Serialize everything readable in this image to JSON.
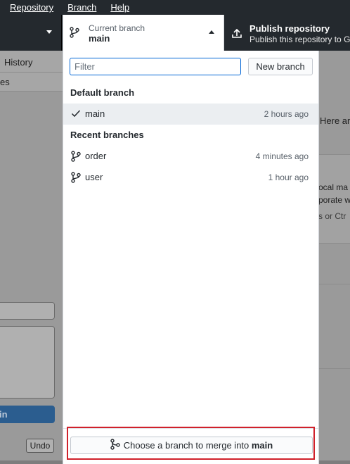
{
  "menu": {
    "items": [
      {
        "label": "Repository"
      },
      {
        "label": "Branch"
      },
      {
        "label": "Help"
      }
    ]
  },
  "toolbar": {
    "current_branch_label": "Current branch",
    "current_branch_value": "main",
    "publish_title": "Publish repository",
    "publish_subtitle": "Publish this repository to G"
  },
  "left_pane": {
    "tab_history": "History",
    "changes_fragment": "es",
    "commit_fragment": "in",
    "undo_label": "Undo"
  },
  "right_pane": {
    "text1": "Here are",
    "text2": "ocal ma",
    "text3": "porate w",
    "text4": "s or  Ctr"
  },
  "dropdown": {
    "filter_placeholder": "Filter",
    "new_branch_label": "New branch",
    "default_heading": "Default branch",
    "default_branch": {
      "name": "main",
      "time": "2 hours ago"
    },
    "recent_heading": "Recent branches",
    "recent_branches": [
      {
        "name": "order",
        "time": "4 minutes ago"
      },
      {
        "name": "user",
        "time": "1 hour ago"
      }
    ],
    "merge_prefix": "Choose a branch to merge into ",
    "merge_target": "main"
  },
  "colors": {
    "toolbar_bg": "#24292e",
    "accent_blue": "#0366d6",
    "highlight_red": "#d0212b"
  }
}
